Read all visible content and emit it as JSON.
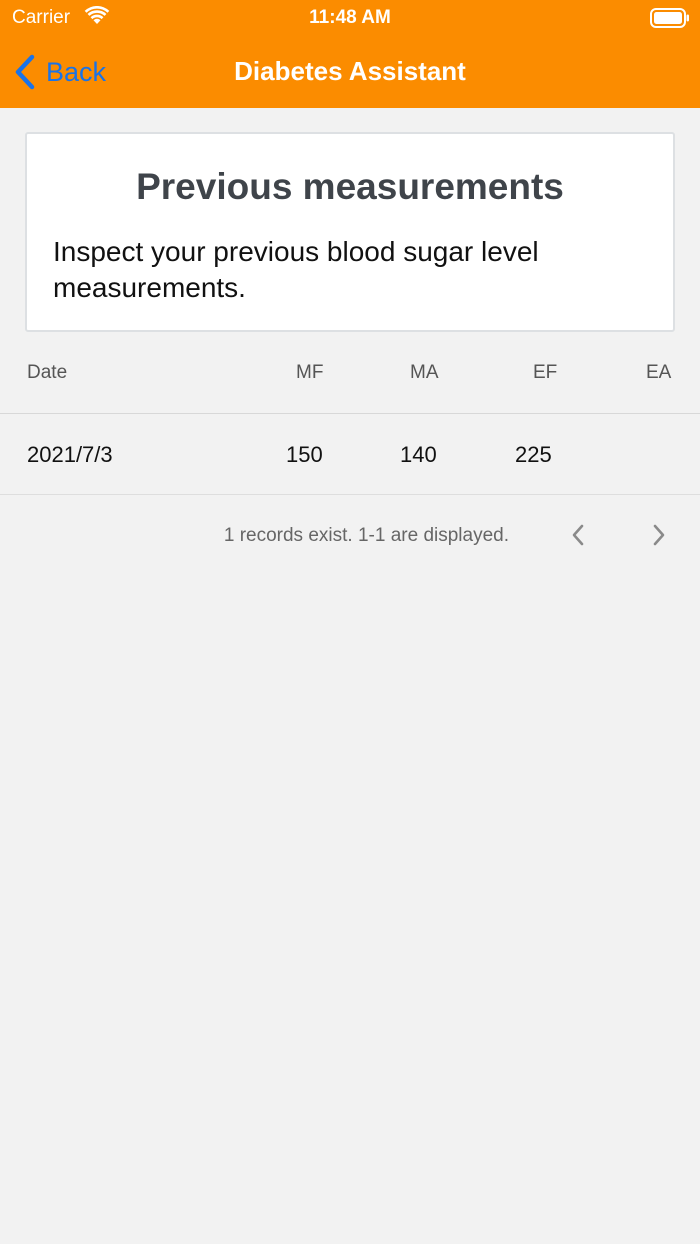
{
  "status": {
    "carrier": "Carrier",
    "time": "11:48 AM"
  },
  "nav": {
    "back_label": "Back",
    "title": "Diabetes Assistant"
  },
  "card": {
    "title": "Previous measurements",
    "text": "Inspect your previous blood sugar level measurements."
  },
  "table": {
    "headers": [
      "Date",
      "MF",
      "MA",
      "EF",
      "EA"
    ],
    "rows": [
      [
        "2021/7/3",
        "150",
        "140",
        "225",
        ""
      ]
    ]
  },
  "pager": {
    "summary": "1 records exist. 1-1 are displayed."
  },
  "colors": {
    "accent": "#fb8c00",
    "back": "#1a73e8",
    "background": "#f2f2f2"
  },
  "icons": [
    "wifi-icon",
    "battery-icon",
    "chevron-left-icon",
    "chevron-left-icon",
    "chevron-right-icon"
  ]
}
